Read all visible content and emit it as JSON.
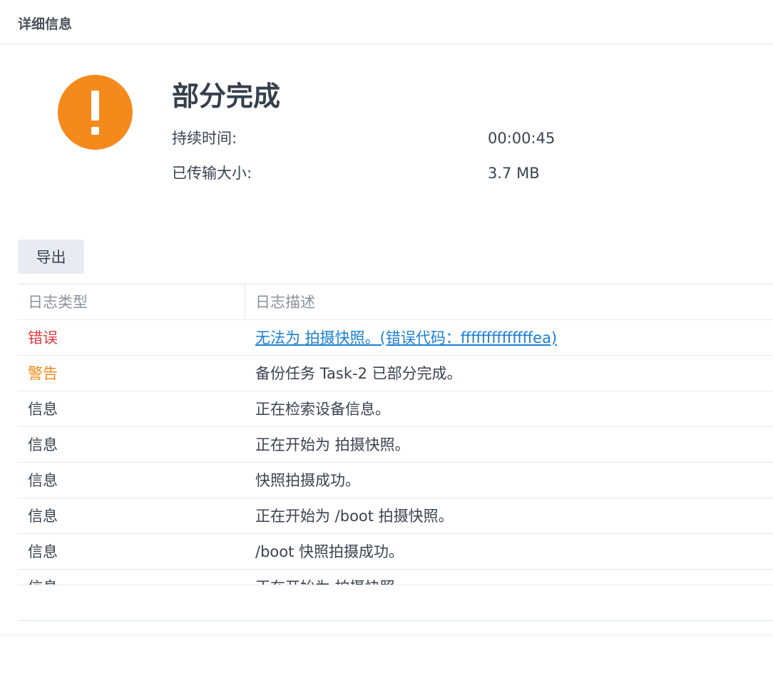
{
  "header": {
    "title": "详细信息"
  },
  "status": {
    "icon": "warning-exclamation-icon",
    "icon_color": "#f58a1c",
    "title": "部分完成",
    "duration_label": "持续时间:",
    "duration_value": "00:00:45",
    "transferred_label": "已传输大小:",
    "transferred_value": "3.7 MB"
  },
  "toolbar": {
    "export_label": "导出"
  },
  "log_table": {
    "columns": [
      "日志类型",
      "日志描述"
    ],
    "rows": [
      {
        "type": "错误",
        "level": "error",
        "description": "无法为 拍摄快照。(错误代码：ffffffffffffffea)",
        "link": true
      },
      {
        "type": "警告",
        "level": "warning",
        "description": "备份任务 Task-2 已部分完成。",
        "link": false
      },
      {
        "type": "信息",
        "level": "info",
        "description": "正在检索设备信息。",
        "link": false
      },
      {
        "type": "信息",
        "level": "info",
        "description": "正在开始为 拍摄快照。",
        "link": false
      },
      {
        "type": "信息",
        "level": "info",
        "description": "快照拍摄成功。",
        "link": false
      },
      {
        "type": "信息",
        "level": "info",
        "description": "正在开始为 /boot 拍摄快照。",
        "link": false
      },
      {
        "type": "信息",
        "level": "info",
        "description": "/boot 快照拍摄成功。",
        "link": false
      },
      {
        "type": "信息",
        "level": "info",
        "description": "正在开始为 拍摄快照。",
        "link": false
      }
    ]
  },
  "colors": {
    "error": "#e5383b",
    "warning": "#f08a1b",
    "link": "#1a7fd6"
  }
}
